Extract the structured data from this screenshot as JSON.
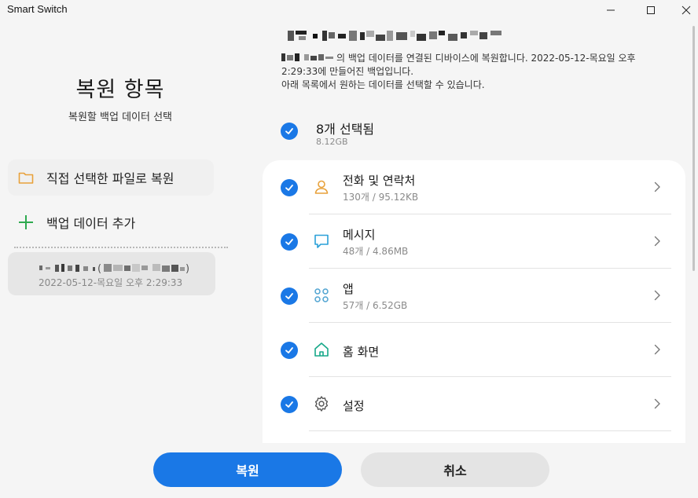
{
  "window": {
    "title": "Smart Switch",
    "controls": [
      "minimize",
      "maximize",
      "close"
    ]
  },
  "left_panel": {
    "title": "복원 항목",
    "subtitle": "복원할 백업 데이터 선택",
    "actions": [
      {
        "label": "직접 선택한 파일로 복원",
        "icon": "folder-icon",
        "icon_color": "#e8a13a"
      },
      {
        "label": "백업 데이터 추가",
        "icon": "plus-icon",
        "icon_color": "#2eaa4f"
      }
    ],
    "backup_item": {
      "date": "2022-05-12-목요일 오후 2:29:33"
    }
  },
  "main": {
    "description_line1": "의 백업 데이터를 연결된 디바이스에 복원합니다. 2022-05-12-목요일 오후",
    "description_line2": "2:29:33에 만들어진 백업입니다.",
    "description_line3": "아래 목록에서 원하는 데이터를 선택할 수 있습니다.",
    "selection": {
      "count_label": "8개 선택됨",
      "size": "8.12GB",
      "checked": true
    },
    "categories": [
      {
        "name": "전화 및 연락처",
        "meta": "130개 / 95.12KB",
        "icon": "person-icon",
        "icon_color": "#e8a13a",
        "checked": true
      },
      {
        "name": "메시지",
        "meta": "48개 / 4.86MB",
        "icon": "message-icon",
        "icon_color": "#2aa0d8",
        "checked": true
      },
      {
        "name": "앱",
        "meta": "57개 / 6.52GB",
        "icon": "apps-icon",
        "icon_color": "#4fa3d1",
        "checked": true
      },
      {
        "name": "홈 화면",
        "meta": "",
        "icon": "home-icon",
        "icon_color": "#17a889",
        "checked": true
      },
      {
        "name": "설정",
        "meta": "",
        "icon": "gear-icon",
        "icon_color": "#555555",
        "checked": true
      }
    ]
  },
  "buttons": {
    "restore": "복원",
    "cancel": "취소"
  },
  "colors": {
    "accent": "#1a78e6",
    "background": "#f5f5f5",
    "card": "#ffffff"
  }
}
